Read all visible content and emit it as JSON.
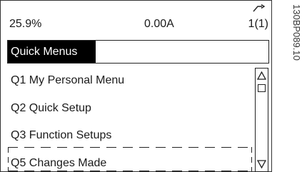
{
  "status_bar": {
    "left_value": "25.9%",
    "middle_value": "0.00A",
    "right_value": "1(1)",
    "indicator_icon": "rotation-direction-icon"
  },
  "menu": {
    "title": "Quick Menus",
    "items": [
      {
        "label": "Q1 My Personal Menu"
      },
      {
        "label": "Q2 Quick Setup"
      },
      {
        "label": "Q3 Function Setups"
      },
      {
        "label": "Q5 Changes Made"
      }
    ]
  },
  "scrollbar": {
    "up_icon": "scroll-up-arrow-icon",
    "down_icon": "scroll-down-arrow-icon"
  },
  "figure_id": "130BP089.10"
}
